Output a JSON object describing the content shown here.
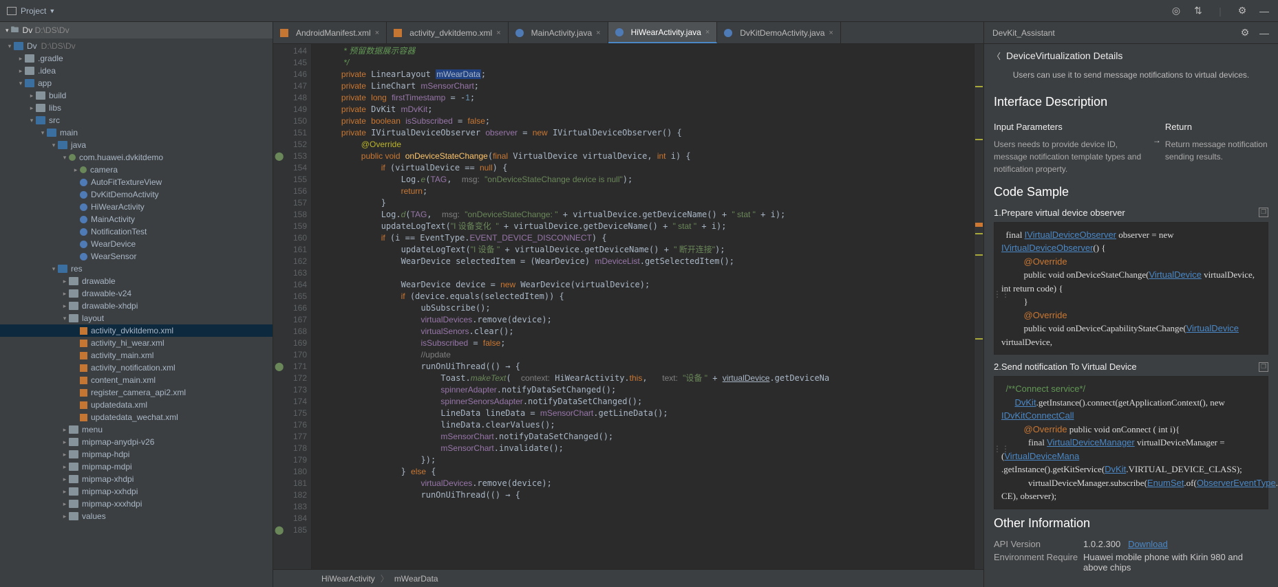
{
  "top": {
    "project_label": "Project",
    "path": "D:\\DS\\Dv"
  },
  "tree": [
    {
      "d": 0,
      "a": "open",
      "i": "folder-blue",
      "t": "Dv",
      "extra": "D:\\DS\\Dv"
    },
    {
      "d": 1,
      "a": "closed",
      "i": "folder",
      "t": ".gradle"
    },
    {
      "d": 1,
      "a": "closed",
      "i": "folder",
      "t": ".idea"
    },
    {
      "d": 1,
      "a": "open",
      "i": "folder-blue",
      "t": "app"
    },
    {
      "d": 2,
      "a": "closed",
      "i": "folder",
      "t": "build"
    },
    {
      "d": 2,
      "a": "closed",
      "i": "folder",
      "t": "libs"
    },
    {
      "d": 2,
      "a": "open",
      "i": "folder-blue",
      "t": "src"
    },
    {
      "d": 3,
      "a": "open",
      "i": "folder-blue",
      "t": "main"
    },
    {
      "d": 4,
      "a": "open",
      "i": "folder-blue",
      "t": "java"
    },
    {
      "d": 5,
      "a": "open",
      "i": "pkg",
      "t": "com.huawei.dvkitdemo"
    },
    {
      "d": 6,
      "a": "closed",
      "i": "pkg",
      "t": "camera"
    },
    {
      "d": 6,
      "a": "none",
      "i": "kt",
      "t": "AutoFitTextureView"
    },
    {
      "d": 6,
      "a": "none",
      "i": "kt",
      "t": "DvKitDemoActivity"
    },
    {
      "d": 6,
      "a": "none",
      "i": "kt",
      "t": "HiWearActivity"
    },
    {
      "d": 6,
      "a": "none",
      "i": "kt",
      "t": "MainActivity"
    },
    {
      "d": 6,
      "a": "none",
      "i": "kt",
      "t": "NotificationTest"
    },
    {
      "d": 6,
      "a": "none",
      "i": "kt",
      "t": "WearDevice"
    },
    {
      "d": 6,
      "a": "none",
      "i": "kt",
      "t": "WearSensor"
    },
    {
      "d": 4,
      "a": "open",
      "i": "folder-blue",
      "t": "res"
    },
    {
      "d": 5,
      "a": "closed",
      "i": "folder",
      "t": "drawable"
    },
    {
      "d": 5,
      "a": "closed",
      "i": "folder",
      "t": "drawable-v24"
    },
    {
      "d": 5,
      "a": "closed",
      "i": "folder",
      "t": "drawable-xhdpi"
    },
    {
      "d": 5,
      "a": "open",
      "i": "folder",
      "t": "layout"
    },
    {
      "d": 6,
      "a": "none",
      "i": "xml",
      "t": "activity_dvkitdemo.xml",
      "sel": true
    },
    {
      "d": 6,
      "a": "none",
      "i": "xml",
      "t": "activity_hi_wear.xml"
    },
    {
      "d": 6,
      "a": "none",
      "i": "xml",
      "t": "activity_main.xml"
    },
    {
      "d": 6,
      "a": "none",
      "i": "xml",
      "t": "activity_notification.xml"
    },
    {
      "d": 6,
      "a": "none",
      "i": "xml",
      "t": "content_main.xml"
    },
    {
      "d": 6,
      "a": "none",
      "i": "xml",
      "t": "register_camera_api2.xml"
    },
    {
      "d": 6,
      "a": "none",
      "i": "xml",
      "t": "updatedata.xml"
    },
    {
      "d": 6,
      "a": "none",
      "i": "xml",
      "t": "updatedata_wechat.xml"
    },
    {
      "d": 5,
      "a": "closed",
      "i": "folder",
      "t": "menu"
    },
    {
      "d": 5,
      "a": "closed",
      "i": "folder",
      "t": "mipmap-anydpi-v26"
    },
    {
      "d": 5,
      "a": "closed",
      "i": "folder",
      "t": "mipmap-hdpi"
    },
    {
      "d": 5,
      "a": "closed",
      "i": "folder",
      "t": "mipmap-mdpi"
    },
    {
      "d": 5,
      "a": "closed",
      "i": "folder",
      "t": "mipmap-xhdpi"
    },
    {
      "d": 5,
      "a": "closed",
      "i": "folder",
      "t": "mipmap-xxhdpi"
    },
    {
      "d": 5,
      "a": "closed",
      "i": "folder",
      "t": "mipmap-xxxhdpi"
    },
    {
      "d": 5,
      "a": "closed",
      "i": "folder",
      "t": "values"
    }
  ],
  "tabs": [
    {
      "i": "xml",
      "label": "AndroidManifest.xml"
    },
    {
      "i": "xml",
      "label": "activity_dvkitdemo.xml"
    },
    {
      "i": "kt",
      "label": "MainActivity.java"
    },
    {
      "i": "kt",
      "label": "HiWearActivity.java",
      "active": true
    },
    {
      "i": "kt",
      "label": "DvKitDemoActivity.java"
    }
  ],
  "line_start": 144,
  "line_end": 185,
  "breadcrumb": {
    "a": "HiWearActivity",
    "b": "mWearData"
  },
  "panel": {
    "title": "DevKit_Assistant",
    "back_label": "DeviceVirtualization Details",
    "note": "Users can use it to send message notifications to virtual devices.",
    "h_interface": "Interface Description",
    "input_h": "Input Parameters",
    "input_t": "Users needs to provide device ID, message notification template types and notification property.",
    "ret_h": "Return",
    "ret_t": "Return message notification sending results.",
    "h_code": "Code Sample",
    "s1": "1.Prepare virtual device observer",
    "s2": "2.Send notification To Virtual Device",
    "h_other": "Other Information",
    "api_k": "API Version",
    "api_v": "1.0.2.300",
    "dl": "Download",
    "env_k": "Environment Require",
    "env_v": "Huawei mobile phone with Kirin 980 and above chips"
  }
}
